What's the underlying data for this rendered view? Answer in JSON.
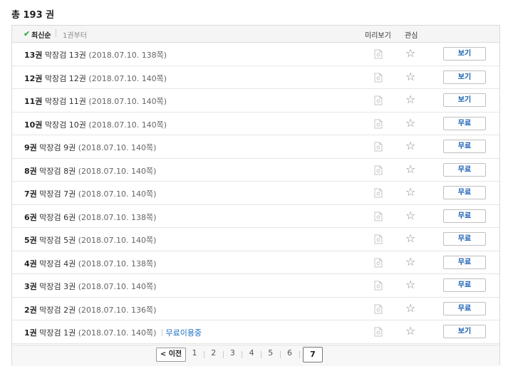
{
  "total": "총 193 권",
  "header": {
    "sort_check": "✔",
    "sort_label": "최신순",
    "sort_alt": "1권부터",
    "col_preview": "미리보기",
    "col_fav": "관심"
  },
  "icons": {
    "preview": "preview-doc-icon",
    "favorite": "star-outline-icon",
    "check": "checkmark-icon"
  },
  "rows": [
    {
      "vol": "13권",
      "title": "막장검 13권",
      "detail": "(2018.07.10. 138쪽)",
      "free_note": "",
      "button": "보기"
    },
    {
      "vol": "12권",
      "title": "막장검 12권",
      "detail": "(2018.07.10. 140쪽)",
      "free_note": "",
      "button": "보기"
    },
    {
      "vol": "11권",
      "title": "막장검 11권",
      "detail": "(2018.07.10. 140쪽)",
      "free_note": "",
      "button": "보기"
    },
    {
      "vol": "10권",
      "title": "막장검 10권",
      "detail": "(2018.07.10. 140쪽)",
      "free_note": "",
      "button": "무료"
    },
    {
      "vol": "9권",
      "title": "막장검 9권",
      "detail": "(2018.07.10. 140쪽)",
      "free_note": "",
      "button": "무료"
    },
    {
      "vol": "8권",
      "title": "막장검 8권",
      "detail": "(2018.07.10. 140쪽)",
      "free_note": "",
      "button": "무료"
    },
    {
      "vol": "7권",
      "title": "막장검 7권",
      "detail": "(2018.07.10. 140쪽)",
      "free_note": "",
      "button": "무료"
    },
    {
      "vol": "6권",
      "title": "막장검 6권",
      "detail": "(2018.07.10. 138쪽)",
      "free_note": "",
      "button": "무료"
    },
    {
      "vol": "5권",
      "title": "막장검 5권",
      "detail": "(2018.07.10. 140쪽)",
      "free_note": "",
      "button": "무료"
    },
    {
      "vol": "4권",
      "title": "막장검 4권",
      "detail": "(2018.07.10. 138쪽)",
      "free_note": "",
      "button": "무료"
    },
    {
      "vol": "3권",
      "title": "막장검 3권",
      "detail": "(2018.07.10. 140쪽)",
      "free_note": "",
      "button": "무료"
    },
    {
      "vol": "2권",
      "title": "막장검 2권",
      "detail": "(2018.07.10. 136쪽)",
      "free_note": "",
      "button": "무료"
    },
    {
      "vol": "1권",
      "title": "막장검 1권",
      "detail": "(2018.07.10. 140쪽)",
      "free_note": "무료이용중",
      "button": "보기"
    }
  ],
  "pager": {
    "prev": "< 이전",
    "pages": [
      "1",
      "2",
      "3",
      "4",
      "5",
      "6"
    ],
    "current": "7"
  },
  "colors": {
    "accent_blue": "#1a5fb4",
    "check_green": "#1a9e2b",
    "free_blue": "#1a6fc4"
  }
}
